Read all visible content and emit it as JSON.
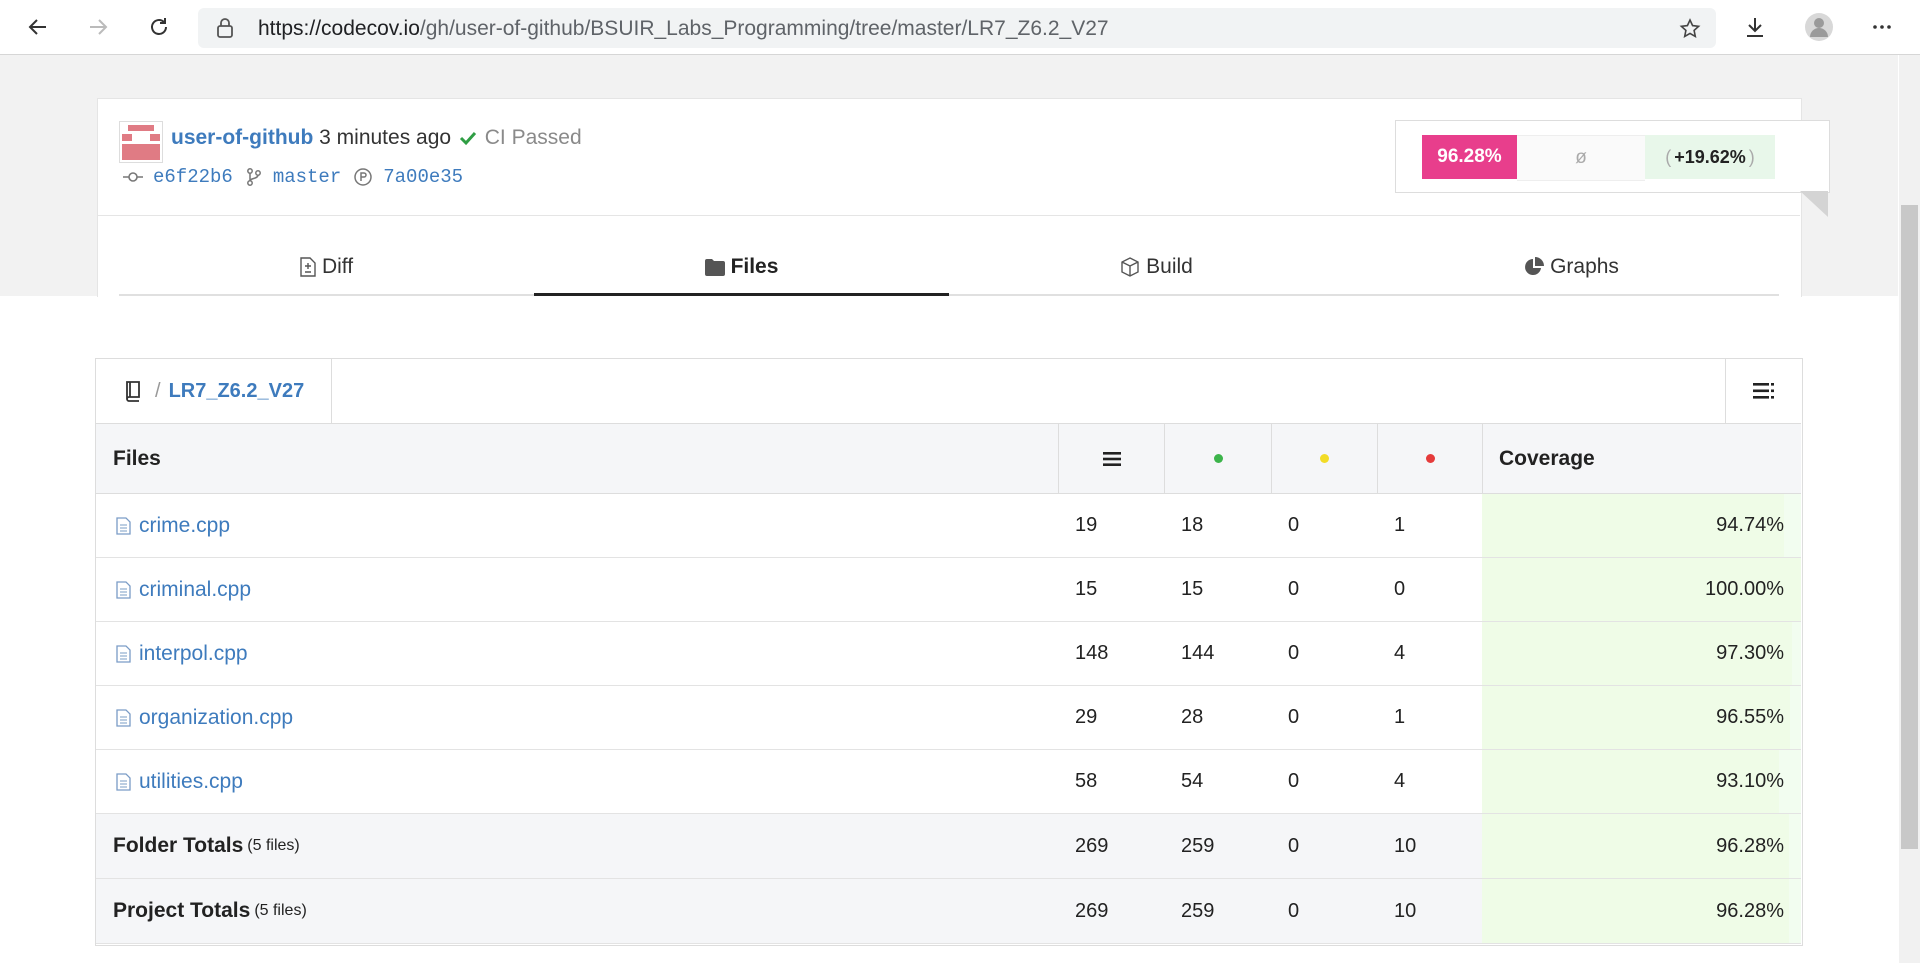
{
  "browser": {
    "url_host": "https://codecov.io",
    "url_path": "/gh/user-of-github/BSUIR_Labs_Programming/tree/master/LR7_Z6.2_V27"
  },
  "commit": {
    "user": "user-of-github",
    "time_ago": "3 minutes ago",
    "ci_status": "CI Passed",
    "commit_sha": "e6f22b6",
    "branch": "master",
    "parent_sha": "7a00e35"
  },
  "coverage_summary": {
    "coverage": "96.28%",
    "na": "ø",
    "delta": "+19.62%",
    "delta_open": "(",
    "delta_close": ")"
  },
  "tabs": [
    {
      "label": "Diff",
      "icon": "diff-icon"
    },
    {
      "label": "Files",
      "icon": "folder-icon",
      "active": true
    },
    {
      "label": "Build",
      "icon": "cube-icon"
    },
    {
      "label": "Graphs",
      "icon": "pie-chart-icon"
    }
  ],
  "breadcrumb": {
    "separator": "/",
    "folder": "LR7_Z6.2_V27"
  },
  "table": {
    "header_files": "Files",
    "header_coverage": "Coverage",
    "colors": {
      "hit": "#3cb44b",
      "partial": "#f2dc27",
      "miss": "#e53b3b"
    },
    "rows": [
      {
        "name": "crime.cpp",
        "lines": "19",
        "hits": "18",
        "partials": "0",
        "misses": "1",
        "coverage": "94.74%",
        "coverage_fraction": 0.9474
      },
      {
        "name": "criminal.cpp",
        "lines": "15",
        "hits": "15",
        "partials": "0",
        "misses": "0",
        "coverage": "100.00%",
        "coverage_fraction": 1.0
      },
      {
        "name": "interpol.cpp",
        "lines": "148",
        "hits": "144",
        "partials": "0",
        "misses": "4",
        "coverage": "97.30%",
        "coverage_fraction": 0.973
      },
      {
        "name": "organization.cpp",
        "lines": "29",
        "hits": "28",
        "partials": "0",
        "misses": "1",
        "coverage": "96.55%",
        "coverage_fraction": 0.9655
      },
      {
        "name": "utilities.cpp",
        "lines": "58",
        "hits": "54",
        "partials": "0",
        "misses": "4",
        "coverage": "93.10%",
        "coverage_fraction": 0.931
      }
    ],
    "folder_totals": {
      "label": "Folder Totals",
      "count": "(5 files)",
      "lines": "269",
      "hits": "259",
      "partials": "0",
      "misses": "10",
      "coverage": "96.28%",
      "coverage_fraction": 0.9628
    },
    "project_totals": {
      "label": "Project Totals",
      "count": "(5 files)",
      "lines": "269",
      "hits": "259",
      "partials": "0",
      "misses": "10",
      "coverage": "96.28%",
      "coverage_fraction": 0.9628
    }
  }
}
